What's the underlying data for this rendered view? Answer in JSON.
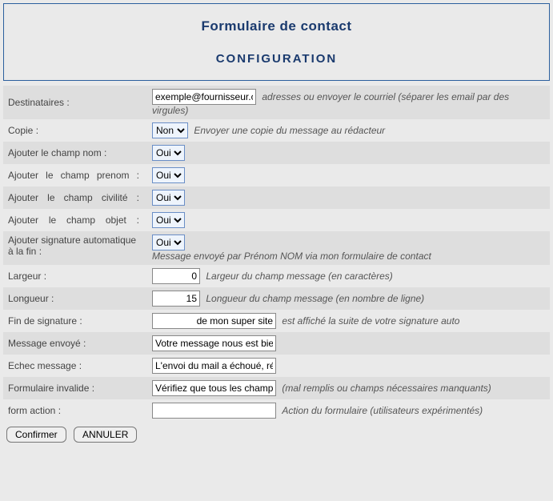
{
  "header": {
    "title": "Formulaire de contact",
    "subtitle": "CONFIGURATION"
  },
  "options": {
    "oui_non": [
      "Oui",
      "Non"
    ]
  },
  "rows": {
    "destinataires": {
      "label": "Destinataires :",
      "value": "exemple@fournisseur.com",
      "hint": "adresses ou envoyer le courriel (séparer les email par des virgules)"
    },
    "copie": {
      "label": "Copie :",
      "value": "Non",
      "hint": "Envoyer une copie du message au rédacteur"
    },
    "champ_nom": {
      "label": "Ajouter le champ nom :",
      "value": "Oui"
    },
    "champ_prenom": {
      "label": "Ajouter le champ prenom :",
      "value": "Oui"
    },
    "champ_civilite": {
      "label": "Ajouter le champ civilité :",
      "value": "Oui"
    },
    "champ_objet": {
      "label": "Ajouter le champ objet :",
      "value": "Oui"
    },
    "signature_auto": {
      "label": "Ajouter signature automatique à la fin :",
      "value": "Oui",
      "hint": "Message envoyé par Prénom NOM via mon formulaire de contact"
    },
    "largeur": {
      "label": "Largeur :",
      "value": "0",
      "hint": "Largeur du champ message (en caractères)"
    },
    "longueur": {
      "label": "Longueur :",
      "value": "15",
      "hint": "Longueur du champ message (en nombre de ligne)"
    },
    "fin_signature": {
      "label": "Fin de signature :",
      "value": "de mon super site",
      "hint": "est affiché la suite de votre signature auto"
    },
    "message_envoye": {
      "label": "Message envoyé :",
      "value": "Votre message nous est bien parvenu"
    },
    "echec_message": {
      "label": "Echec message :",
      "value": "L'envoi du mail a échoué, réessayez"
    },
    "form_invalide": {
      "label": "Formulaire invalide :",
      "value": "Vérifiez que tous les champs sont remplis",
      "hint": "(mal remplis ou champs nécessaires manquants)"
    },
    "form_action": {
      "label": "form action :",
      "value": "",
      "hint": "Action du formulaire (utilisateurs expérimentés)"
    }
  },
  "buttons": {
    "confirm": "Confirmer",
    "cancel": "ANNULER"
  }
}
